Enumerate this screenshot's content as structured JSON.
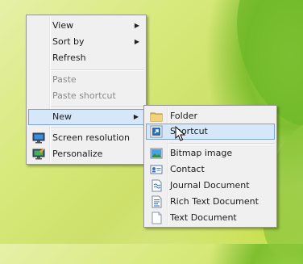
{
  "context_menu": {
    "items": [
      {
        "label": "View",
        "submenu": true
      },
      {
        "label": "Sort by",
        "submenu": true
      },
      {
        "label": "Refresh"
      },
      {
        "label": "Paste",
        "disabled": true
      },
      {
        "label": "Paste shortcut",
        "disabled": true
      },
      {
        "label": "New",
        "submenu": true,
        "highlighted": true
      },
      {
        "label": "Screen resolution",
        "icon": "monitor-icon"
      },
      {
        "label": "Personalize",
        "icon": "personalize-icon"
      }
    ]
  },
  "new_submenu": {
    "items": [
      {
        "label": "Folder",
        "icon": "folder-icon"
      },
      {
        "label": "Shortcut",
        "icon": "shortcut-icon",
        "highlighted": true
      },
      {
        "label": "Bitmap image",
        "icon": "bitmap-icon"
      },
      {
        "label": "Contact",
        "icon": "contact-icon"
      },
      {
        "label": "Journal Document",
        "icon": "journal-icon"
      },
      {
        "label": "Rich Text Document",
        "icon": "rich-text-icon"
      },
      {
        "label": "Text Document",
        "icon": "text-document-icon"
      }
    ]
  },
  "colors": {
    "highlight_bg": "#d5e7f8",
    "highlight_border": "#7da2ce",
    "menu_bg": "#f0f0f0"
  }
}
